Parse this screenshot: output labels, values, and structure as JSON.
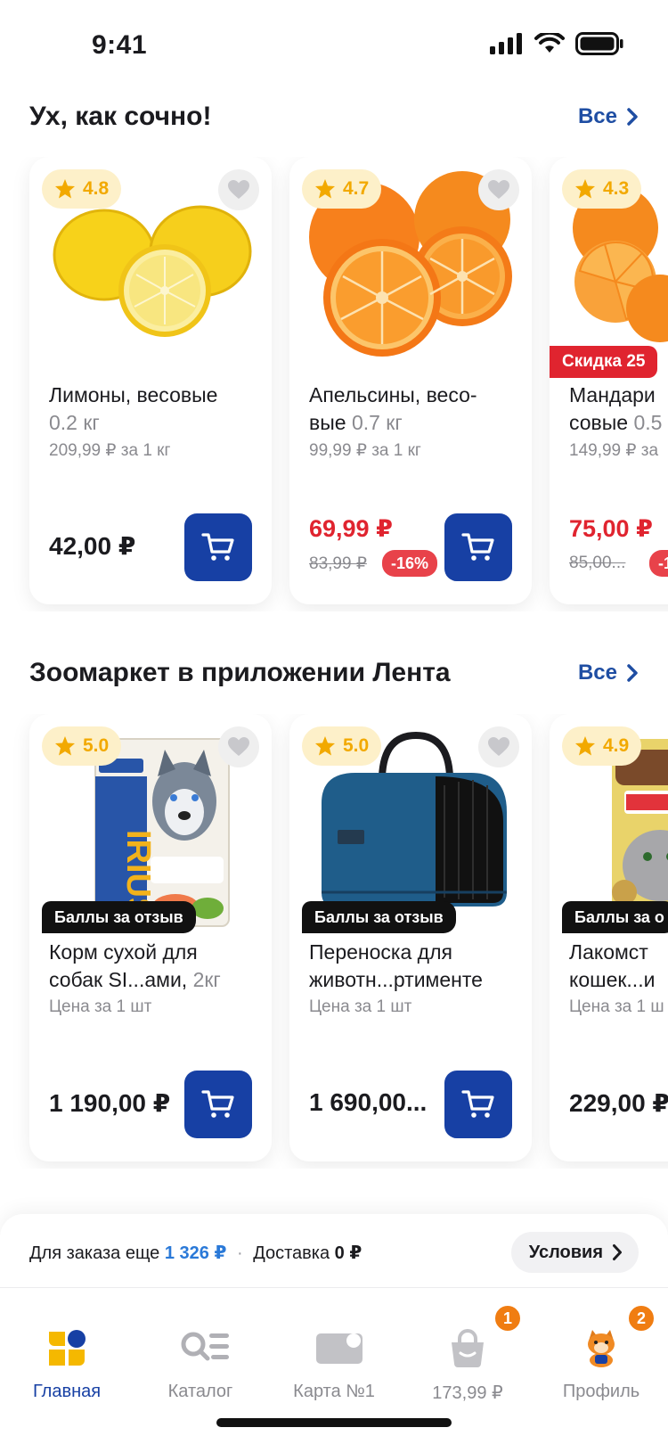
{
  "status_bar": {
    "time": "9:41"
  },
  "section1": {
    "title": "Ух, как сочно!",
    "see_all": "Все",
    "products": [
      {
        "rating": "4.8",
        "name_line1": "Лимоны, весовые",
        "weight": "0.2 кг",
        "unit_price": "209,99 ₽ за 1 кг",
        "price": "42,00 ₽"
      },
      {
        "rating": "4.7",
        "name_line1": "Апельсины, весо-",
        "name_line2": "вые",
        "weight": "0.7 кг",
        "unit_price": "99,99 ₽ за 1 кг",
        "sale_price": "69,99 ₽",
        "old_price": "83,99 ₽",
        "discount": "-16%"
      },
      {
        "rating": "4.3",
        "ribbon": "Скидка 25",
        "name_line1": "Мандари",
        "name_line2": "совые",
        "weight": "0.5",
        "unit_price": "149,99 ₽ за",
        "sale_price": "75,00 ₽",
        "old_price": "85,00...",
        "discount": "-1"
      }
    ]
  },
  "section2": {
    "title": "Зоомаркет в приложении Лента",
    "see_all": "Все",
    "products": [
      {
        "rating": "5.0",
        "ribbon": "Баллы за отзыв",
        "name_line1": "Корм сухой для",
        "name_line2": "собак SI...ами,",
        "weight": "2кг",
        "unit_price": "Цена за 1 шт",
        "price": "1 190,00 ₽"
      },
      {
        "rating": "5.0",
        "ribbon": "Баллы за отзыв",
        "name_line1": "Переноска для",
        "name_line2": "животн...ртименте",
        "unit_price": "Цена за 1 шт",
        "price": "1 690,00..."
      },
      {
        "rating": "4.9",
        "ribbon": "Баллы за о",
        "name_line1": "Лакомст",
        "name_line2": "кошек...и",
        "unit_price": "Цена за 1 ш",
        "price": "229,00 ₽"
      }
    ]
  },
  "delivery": {
    "prefix": "Для заказа еще",
    "amount": "1 326 ₽",
    "separator": "·",
    "delivery_label": "Доставка",
    "delivery_price": "0 ₽",
    "conditions_label": "Условия"
  },
  "tabbar": {
    "tabs": [
      {
        "label": "Главная",
        "icon": "home-icon",
        "active": true
      },
      {
        "label": "Каталог",
        "icon": "catalog-icon"
      },
      {
        "label": "Карта №1",
        "icon": "card-icon"
      },
      {
        "label": "173,99 ₽",
        "icon": "cart-bag-icon",
        "badge": "1"
      },
      {
        "label": "Профиль",
        "icon": "profile-icon",
        "badge": "2"
      }
    ]
  },
  "colors": {
    "brand_blue": "#1740a4",
    "sale_red": "#e0242f",
    "rating_yellow": "#f2a900",
    "badge_orange": "#f07d12",
    "link_blue": "#1f4ea3"
  }
}
